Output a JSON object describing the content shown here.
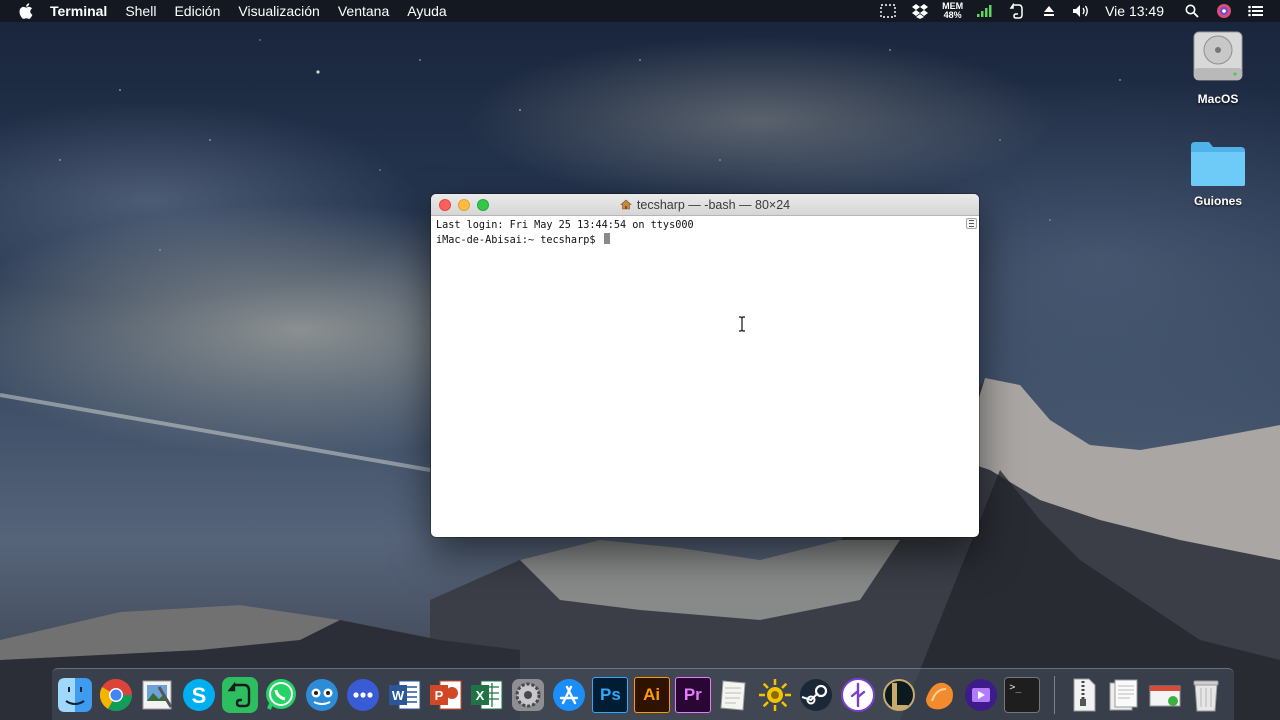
{
  "menubar": {
    "app_name": "Terminal",
    "items": [
      "Shell",
      "Edición",
      "Visualización",
      "Ventana",
      "Ayuda"
    ],
    "memory": {
      "label": "MEM",
      "value": "48%"
    },
    "clock": "Vie 13:49"
  },
  "desktop_icons": [
    {
      "label": "MacOS"
    },
    {
      "label": "Guiones"
    }
  ],
  "terminal": {
    "title": "tecsharp — -bash — 80×24",
    "lines": [
      "Last login: Fri May 25 13:44:54 on ttys000",
      "iMac-de-Abisai:~ tecsharp$ "
    ]
  },
  "dock": {
    "text_labels": {
      "photoshop": "Ps",
      "illustrator": "Ai",
      "premiere": "Pr",
      "word": "W",
      "powerpoint": "P",
      "excel": "X",
      "terminal_prompt": ">_"
    },
    "apps": [
      "finder-icon",
      "chrome-icon",
      "preview-icon",
      "skype-icon",
      "evernote-icon",
      "whatsapp-icon",
      "tweetbot-icon",
      "messages-icon",
      "word-icon",
      "powerpoint-icon",
      "excel-icon",
      "system-preferences-icon",
      "app-store-icon",
      "photoshop-icon",
      "illustrator-icon",
      "premiere-icon",
      "textedit-icon",
      "brightness-icon",
      "steam-icon",
      "utility-icon",
      "league-icon",
      "fruit-icon",
      "video-icon",
      "terminal-icon",
      "zip-icon",
      "documents-icon",
      "download-icon",
      "trash-icon"
    ]
  },
  "colors": {
    "menubar_bg": "#16181e",
    "close": "#fc605b",
    "minimize": "#fdbc40",
    "maximize": "#34c84a",
    "folder_blue": "#5ec3f5"
  }
}
